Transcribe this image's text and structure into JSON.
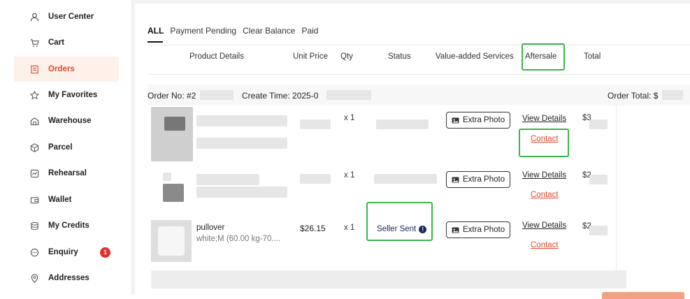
{
  "sidebar": {
    "items": [
      {
        "label": "User Center",
        "icon": "user-icon"
      },
      {
        "label": "Cart",
        "icon": "cart-icon"
      },
      {
        "label": "Orders",
        "icon": "orders-icon"
      },
      {
        "label": "My Favorites",
        "icon": "star-icon"
      },
      {
        "label": "Warehouse",
        "icon": "warehouse-icon"
      },
      {
        "label": "Parcel",
        "icon": "parcel-icon"
      },
      {
        "label": "Rehearsal",
        "icon": "rehearsal-icon"
      },
      {
        "label": "Wallet",
        "icon": "wallet-icon"
      },
      {
        "label": "My Credits",
        "icon": "credits-icon"
      },
      {
        "label": "Enquiry",
        "icon": "enquiry-icon"
      },
      {
        "label": "Addresses",
        "icon": "address-icon"
      }
    ],
    "active": "Orders",
    "enquiry_badge": "1",
    "accent": "#e0492a"
  },
  "tabs": [
    "ALL",
    "Payment Pending",
    "Clear Balance",
    "Paid"
  ],
  "active_tab": "ALL",
  "table_headers": {
    "product": "Product Details",
    "unit_price": "Unit Price",
    "qty": "Qty",
    "status": "Status",
    "services": "Value-added Services",
    "aftersale": "Aftersale",
    "total": "Total"
  },
  "order": {
    "no_label": "Order No: #2",
    "create_label": "Create Time: 2025-0",
    "total_label": "Order Total: $"
  },
  "rows": [
    {
      "qty": "x 1",
      "service": "Extra Photo",
      "view": "View Details",
      "contact": "Contact",
      "total_prefix": "$3"
    },
    {
      "qty": "x 1",
      "service": "Extra Photo",
      "view": "View Details",
      "contact": "Contact",
      "total_prefix": "$2"
    },
    {
      "title": "pullover",
      "subtitle": "white;M (60.00 kg-70....",
      "price": "$26.15",
      "qty": "x 1",
      "status": "Seller Sent",
      "service": "Extra Photo",
      "view": "View Details",
      "contact": "Contact",
      "total_prefix": "$2"
    }
  ],
  "highlight_color": "#3cb44b"
}
